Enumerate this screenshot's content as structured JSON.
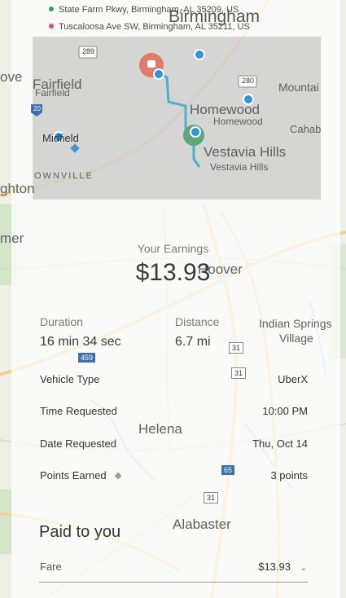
{
  "map": {
    "addresses": [
      {
        "text": "State Farm Pkwy, Birmingham, AL 35209, US",
        "dot_color": "#2e9e52"
      },
      {
        "text": "Tuscaloosa Ave SW, Birmingham, AL 35211, US",
        "dot_color": "#d9534f"
      }
    ],
    "cities": {
      "birmingham": "Birmingham",
      "fairfield": "Fairfield",
      "fairfield_small": "Fairfield",
      "midfield": "Midfield",
      "ownville": "OWNVILLE",
      "homewood": "Homewood",
      "homewood_small": "Homewood",
      "vestavia": "Vestavia Hills",
      "vestavia_small": "Vestavia Hills",
      "mountain": "Mountai",
      "cahaba": "Cahab",
      "ove": "ove",
      "ghton": "ghton",
      "mer": "mer",
      "hoover": "Hoover",
      "indian_springs_1": "Indian Springs",
      "indian_springs_2": "Village",
      "helena": "Helena",
      "alabaster": "Alabaster"
    },
    "shields": {
      "r289": "289",
      "r280": "280",
      "r20": "20",
      "r459": "459",
      "r31a": "31",
      "r31b": "31",
      "r31c": "31",
      "r65": "65"
    }
  },
  "earnings": {
    "label": "Your Earnings",
    "value": "$13.93"
  },
  "duration": {
    "label": "Duration",
    "value": "16 min 34 sec"
  },
  "distance": {
    "label": "Distance",
    "value": "6.7 mi"
  },
  "rows": [
    {
      "label": "Vehicle Type",
      "value": "UberX"
    },
    {
      "label": "Time Requested",
      "value": "10:00 PM"
    },
    {
      "label": "Date Requested",
      "value": "Thu, Oct 14"
    },
    {
      "label": "Points Earned",
      "value": "3 points"
    }
  ],
  "paid": {
    "title": "Paid to you",
    "fare_label": "Fare",
    "fare_value": "$13.93"
  }
}
